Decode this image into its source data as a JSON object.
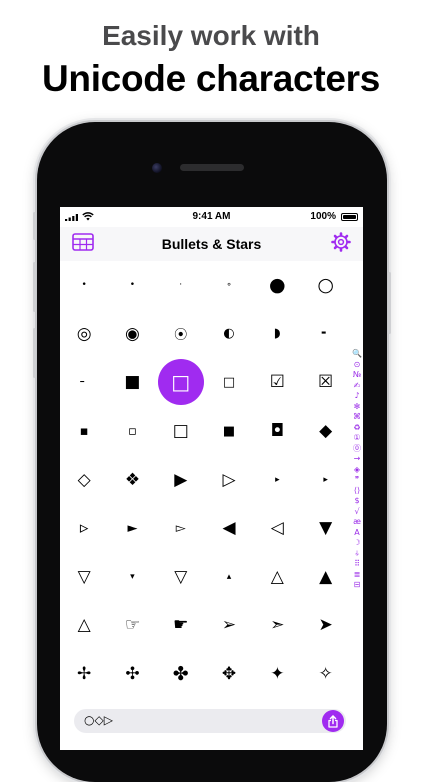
{
  "headline": {
    "line1": "Easily work with",
    "line2": "Unicode characters"
  },
  "status_bar": {
    "time": "9:41 AM",
    "battery": "100%"
  },
  "nav": {
    "title": "Bullets & Stars",
    "left_icon": "table-icon",
    "right_icon": "gear-icon"
  },
  "grid": {
    "rows": [
      [
        "•",
        "•",
        "·",
        "∘",
        "●",
        "○"
      ],
      [
        "◎",
        "◉",
        "⦿",
        "◐",
        "◗",
        "╸"
      ],
      [
        "╴",
        "■",
        "□",
        "□",
        "☑",
        "☒"
      ],
      [
        "▪",
        "▫",
        "□",
        "■",
        "◘",
        "◆"
      ],
      [
        "◇",
        "❖",
        "▶",
        "▷",
        "▸",
        "▸"
      ],
      [
        "▹",
        "►",
        "▻",
        "◀",
        "◁",
        "▼"
      ],
      [
        "▽",
        "▾",
        "▽",
        "▴",
        "△",
        "▲"
      ],
      [
        "△",
        "☞",
        "☛",
        "➢",
        "➣",
        "➤"
      ],
      [
        "✢",
        "✣",
        "✤",
        "✥",
        "✦",
        "✧"
      ]
    ],
    "selected": "□"
  },
  "index_bar": [
    "🔍",
    "⊙",
    "№",
    "✍",
    "♪",
    "✻",
    "⌘",
    "♻",
    "①",
    "⓪",
    "→",
    "◈",
    "❞",
    "⟨⟩",
    "$",
    "√",
    "æ",
    "A",
    "☽",
    "⍭",
    "⠿",
    "≣",
    "⊟"
  ],
  "composer": {
    "text": "○◇▷"
  },
  "colors": {
    "accent": "#a02bf0",
    "nav_background": "#f7f7f9",
    "composer_background": "#ebebef"
  }
}
